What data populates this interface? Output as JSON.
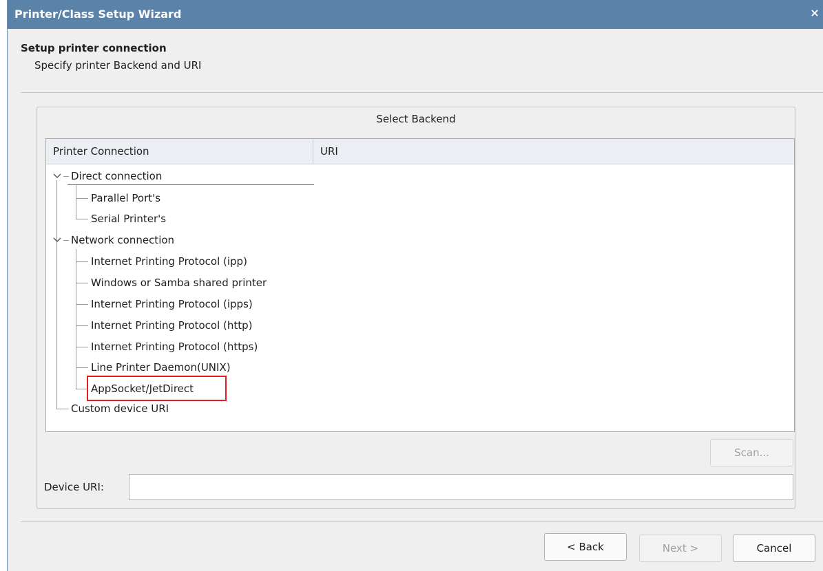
{
  "window": {
    "title": "Printer/Class Setup Wizard",
    "close_glyph": "×"
  },
  "header": {
    "title": "Setup printer connection",
    "subtitle": "Specify printer Backend and URI"
  },
  "backend_group": {
    "title": "Select Backend",
    "columns": [
      "Printer Connection",
      "URI"
    ],
    "tree": {
      "direct": {
        "label": "Direct connection",
        "children": [
          "Parallel Port's",
          "Serial Printer's"
        ]
      },
      "network": {
        "label": "Network connection",
        "children": [
          "Internet Printing Protocol (ipp)",
          "Windows or Samba shared printer",
          "Internet Printing Protocol (ipps)",
          "Internet Printing Protocol (http)",
          "Internet Printing Protocol (https)",
          "Line Printer Daemon(UNIX)",
          "AppSocket/JetDirect"
        ]
      },
      "custom": {
        "label": "Custom device URI"
      }
    },
    "scan_label": "Scan...",
    "device_uri_label": "Device URI:",
    "device_uri_value": ""
  },
  "footer": {
    "back_label": "< Back",
    "next_label": "Next >",
    "cancel_label": "Cancel"
  },
  "colors": {
    "titlebar": "#5b82a8",
    "highlight": "#e02020"
  }
}
